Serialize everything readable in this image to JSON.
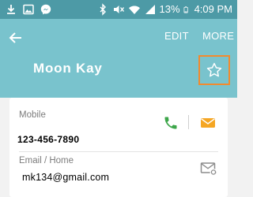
{
  "status_bar": {
    "battery_percent": "13%",
    "time": "4:09 PM",
    "icons": [
      "download-icon",
      "gallery-icon",
      "messenger-icon",
      "bluetooth-icon",
      "mute-icon",
      "wifi-icon",
      "signal-icon",
      "battery-icon"
    ]
  },
  "header": {
    "back_icon": "back-arrow-icon",
    "edit_label": "EDIT",
    "more_label": "MORE",
    "contact_name": "Moon Kay",
    "favorite_icon": "star-outline-icon"
  },
  "mobile": {
    "label": "Mobile",
    "value": "123-456-7890",
    "call_icon": "phone-icon",
    "message_icon": "message-icon"
  },
  "email": {
    "label": "Email / Home",
    "value": "mk134@gmail.com",
    "send_icon": "send-email-icon"
  },
  "colors": {
    "status_bar": "#4d9aa6",
    "header": "#79c3cd",
    "highlight_box": "#f28a2e",
    "phone_icon": "#3da64a",
    "message_icon": "#f5a623",
    "background": "#f2f2f2"
  }
}
